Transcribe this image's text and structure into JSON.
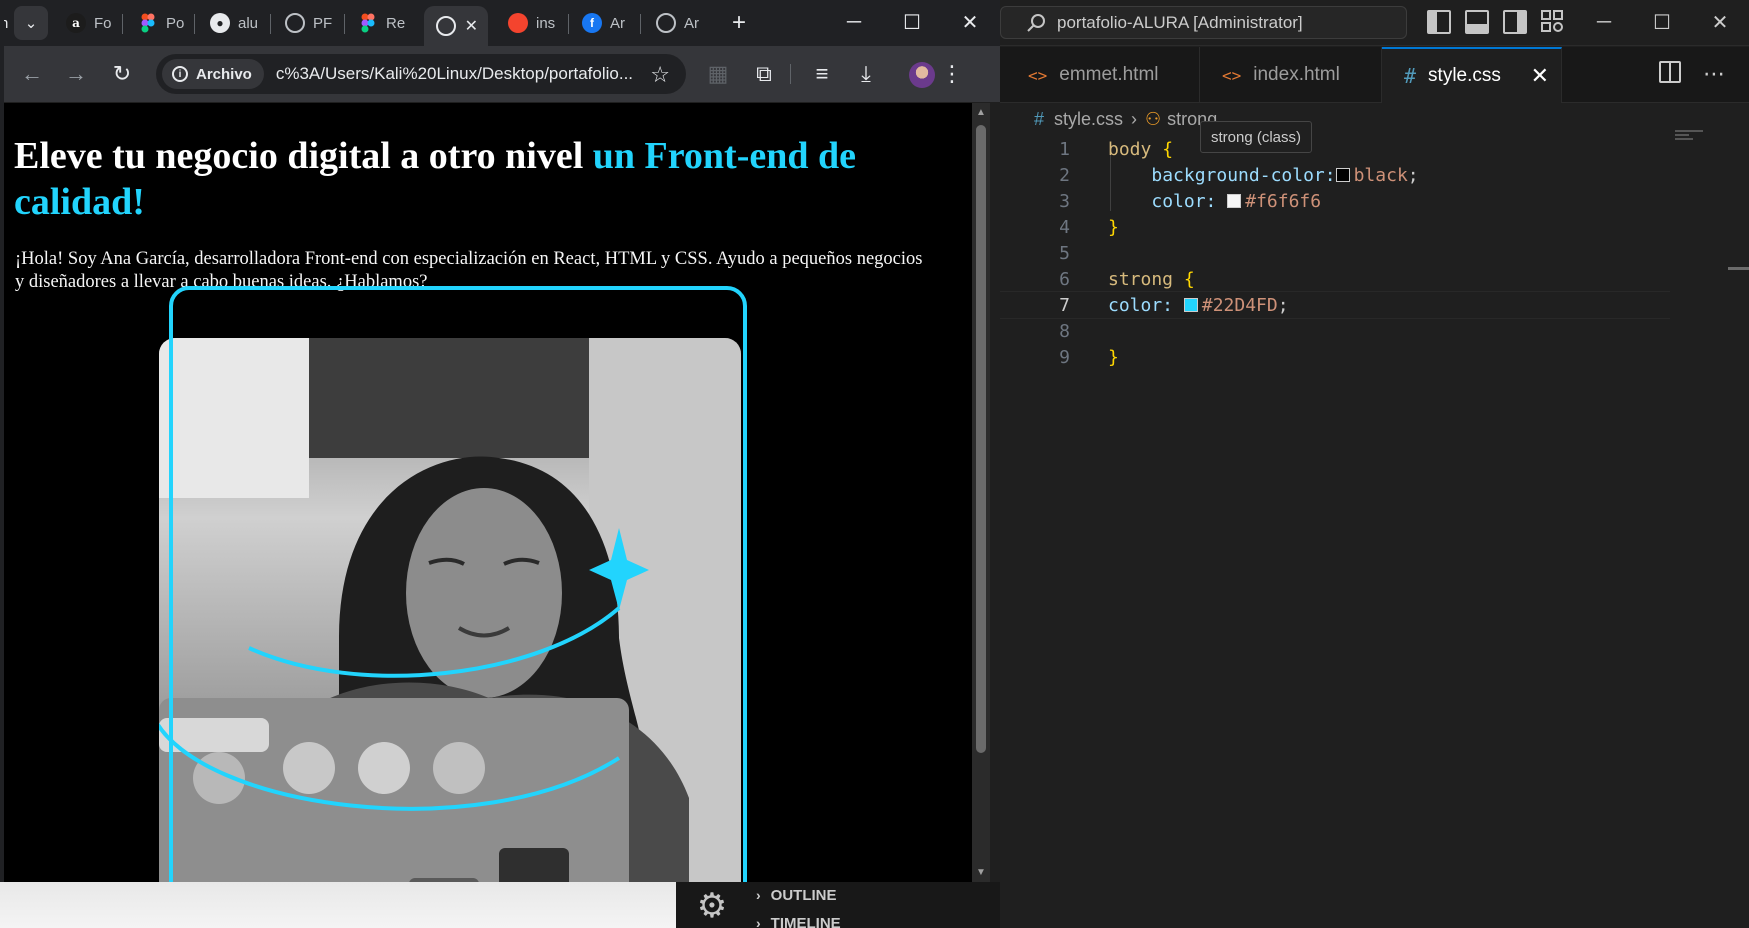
{
  "vscode": {
    "search_text": "portafolio-ALURA [Administrator]",
    "tabs": [
      {
        "icon": "<>",
        "label": "emmet.html"
      },
      {
        "icon": "<>",
        "label": "index.html"
      },
      {
        "icon": "#",
        "label": "style.css",
        "active": true
      }
    ],
    "tab_close": "✕",
    "breadcrumb": {
      "file": "style.css",
      "symbol": "strong"
    },
    "tooltip": "strong (class)",
    "code_lines": [
      {
        "n": "1"
      },
      {
        "n": "2"
      },
      {
        "n": "3"
      },
      {
        "n": "4"
      },
      {
        "n": "5"
      },
      {
        "n": "6"
      },
      {
        "n": "7"
      },
      {
        "n": "8"
      },
      {
        "n": "9"
      }
    ],
    "code": {
      "body_sel": "body",
      "open_brace": "{",
      "close_brace": "}",
      "bg_prop": "background-color:",
      "bg_val": "black",
      "color_prop": "color:",
      "color_val": "#f6f6f6",
      "strong_sel": "strong",
      "strong_color_val": "#22D4FD",
      "semicolon": ";"
    },
    "swatches": {
      "black": "#000000",
      "f6f6f6": "#f6f6f6",
      "accent": "#22D4FD"
    },
    "bottom_panel": [
      "OUTLINE",
      "TIMELINE"
    ],
    "window_controls": [
      "─",
      "☐",
      "✕"
    ]
  },
  "browser": {
    "tabs": [
      {
        "fav": "a",
        "label": "Fo"
      },
      {
        "fav": "figma",
        "label": "Po"
      },
      {
        "fav": "github",
        "label": "alu"
      },
      {
        "fav": "globe",
        "label": "PF"
      },
      {
        "fav": "figma",
        "label": "Re"
      },
      {
        "fav": "globe",
        "label": "",
        "active": true
      },
      {
        "fav": "brave",
        "label": "ins"
      },
      {
        "fav": "f",
        "label": "Ar"
      },
      {
        "fav": "globe",
        "label": "Ar"
      }
    ],
    "new_tab": "+",
    "chip_label": "Archivo",
    "url": "c%3A/Users/Kali%20Linux/Desktop/portafolio...",
    "window_controls": [
      "─",
      "☐",
      "✕"
    ]
  },
  "page": {
    "h1_plain": "Eleve tu negocio digital a otro nivel ",
    "h1_accent": "un Front-end de calidad!",
    "paragraph": "¡Hola! Soy Ana García, desarrolladora Front-end con especialización en React, HTML y CSS. Ayudo a pequeños negocios y diseñadores a llevar a cabo buenas ideas. ¿Hablamos?",
    "accent_color": "#22d4fd",
    "photo_alt": "Ana García working on a laptop"
  }
}
